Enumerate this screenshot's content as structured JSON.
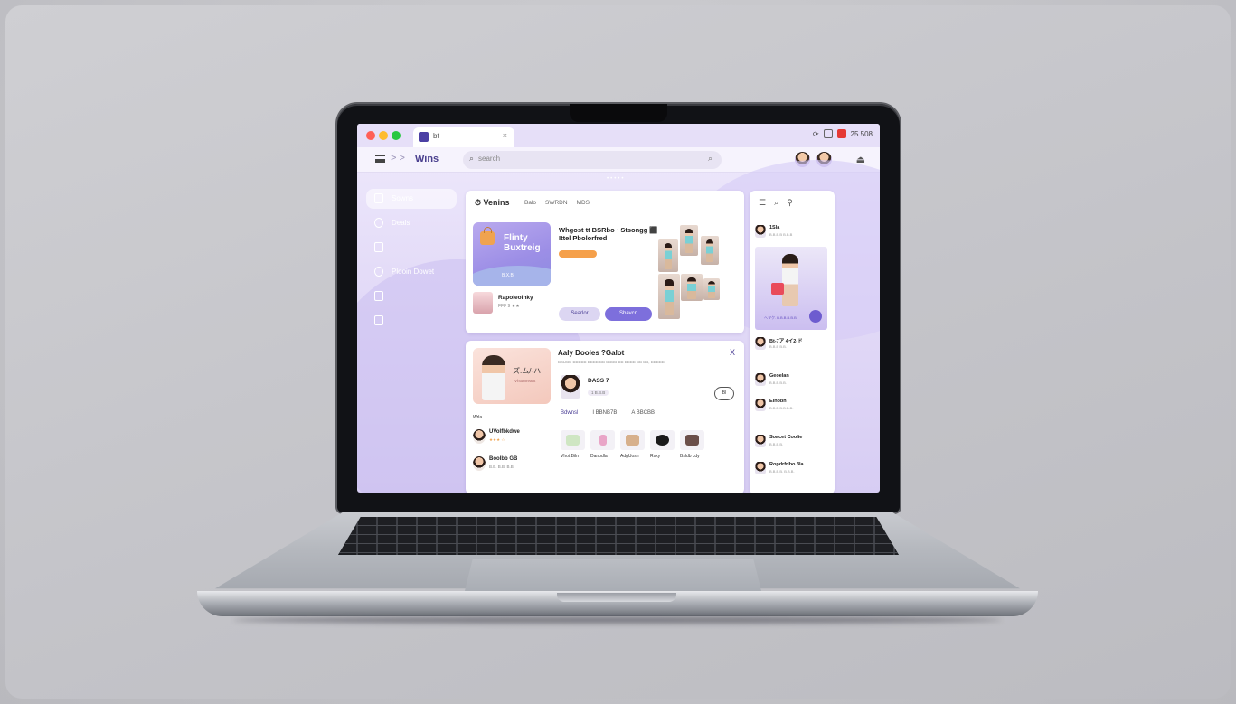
{
  "browser": {
    "tab_label": "bt",
    "tab_close": "×",
    "status_text": "25.508",
    "window_dots": [
      "#ff5f57",
      "#febc2e",
      "#28c840"
    ]
  },
  "toolbar": {
    "nav_arrows": "> >",
    "brand": "Wins",
    "search_placeholder": "search",
    "search_icon": "search-icon",
    "account_icon": "⏏"
  },
  "sidebar": {
    "items": [
      {
        "label": "Sowns",
        "active": true
      },
      {
        "label": "Deals"
      },
      {
        "label": ""
      },
      {
        "label": "Plooin Dowet"
      },
      {
        "label": ""
      },
      {
        "label": ""
      }
    ]
  },
  "top_card": {
    "title": "Venins",
    "tabs": [
      "Balo",
      "SWRDN",
      "MDS"
    ],
    "more": "···",
    "promo_title": "Flinty Buxtreig",
    "promo_button": "B.X.B",
    "feature_title": "Whgost tt BSRbo · Stsongg ⬛ Ittel Pbolorfred",
    "button_secondary": "Searlor",
    "button_primary": "Sbavcn",
    "mini_title": "Rapoleolnky",
    "mini_sub": "FFF 9 ★★"
  },
  "bottom_card": {
    "promo_jp": "ズ.ム/-ハ",
    "promo_sub": "Vhtomreant",
    "heading": "Aaly Dooles ?Galot",
    "subheading": "BSDBB BBBBB BBBB BB BBBB BB BBBB BB BB, BBBBB.",
    "close": "X",
    "list_header": "Wrla",
    "list": [
      {
        "name": "UVolfbkdwe",
        "sub": "★★★ ☆"
      },
      {
        "name": "Boolbb GB",
        "sub": "B.B. B.B. B.B."
      }
    ],
    "profile_name": "DASS 7",
    "profile_status": "1 B.B.B",
    "follow": "Bl",
    "subtabs": [
      "Bdwnsl",
      "I BBNB7B",
      "A BBCBB"
    ],
    "products": [
      "Vhot Biln",
      "Danbdla",
      "AdgUosh",
      "Rsky",
      "Bsldb cdy"
    ]
  },
  "right_panel": {
    "icons": [
      "☰",
      "⌕",
      "⚲"
    ],
    "header_name": "1Sla",
    "header_sub": "B.B.B.B B.B.B",
    "image_caption": "ヘヲク. B.B.B.B.B.B",
    "items": [
      {
        "name": "Bt-7ア 4イ2-ド",
        "sub": "B.B.B B.B."
      },
      {
        "name": "Geoelan",
        "sub": "B.B.B.B.B."
      },
      {
        "name": "Elnobh",
        "sub": "B.B.B.B.B.B.B."
      },
      {
        "name": "Soacet Coolie",
        "sub": "B.B.B.B."
      },
      {
        "name": "Ropdrfrlbo 3la",
        "sub": "B.B.B.B. B.B.B."
      }
    ]
  }
}
